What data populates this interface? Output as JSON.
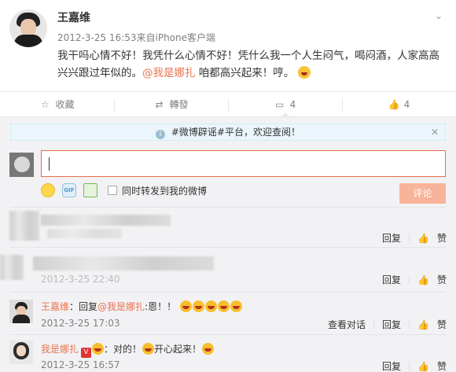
{
  "post": {
    "author": "王嘉维",
    "time": "2012-3-25 16:53",
    "source": "来自iPhone客户端",
    "text_a": "我干吗心情不好！我凭什么心情不好！凭什么我一个人生闷气，喝闷酒，人家高高兴兴跟过年似的。",
    "mention": "@我是娜扎",
    "text_b": " 咱都高兴起来！哼。"
  },
  "actions": {
    "favorite": "收藏",
    "repost": "轉發",
    "comment_count": "4",
    "like_count": "4"
  },
  "notice": {
    "text": "#微博辟谣#平台，欢迎查阅！"
  },
  "composer": {
    "value": "",
    "sync_label": "同时转发到我的微博",
    "submit": "评论"
  },
  "comments": [
    {
      "reply": "回复",
      "like": "赞",
      "time_visible": ""
    },
    {
      "reply": "回复",
      "like": "赞",
      "time_visible": "2012-3-25 22:40"
    },
    {
      "name": "王嘉维",
      "text_pre": "：回复",
      "mention": "@我是娜扎",
      "text_post": ":恩！！",
      "time": "2012-3-25 17:03",
      "view_thread": "查看对话",
      "reply": "回复",
      "like": "赞"
    },
    {
      "name": "我是娜扎",
      "text": "：对的！",
      "text2": "开心起来！",
      "time": "2012-3-25 16:57",
      "reply": "回复",
      "like": "赞"
    }
  ],
  "icons": {
    "favorite": "star-icon",
    "repost": "repost-icon",
    "comment": "comment-icon",
    "like": "thumbs-up-icon",
    "expand": "chevron-down-icon",
    "info": "info-icon",
    "close": "close-icon",
    "emotion": "emotion-icon",
    "gif": "gif-icon",
    "image": "image-icon"
  },
  "colors": {
    "accent": "#eb7350",
    "submit_disabled": "#f7b49a",
    "notice_bg": "#eaf6fb",
    "comments_bg": "#f2f2f5"
  }
}
